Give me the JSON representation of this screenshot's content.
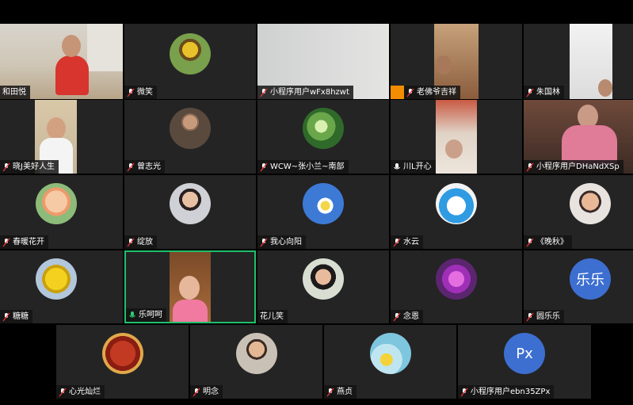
{
  "participants": [
    {
      "name": "和田悦"
    },
    {
      "name": "微笑"
    },
    {
      "name": "小程序用户wFx8hzwt"
    },
    {
      "name": "老佛爷吉祥"
    },
    {
      "name": "朱国林"
    },
    {
      "name": "晓J美好人生"
    },
    {
      "name": "曾志光"
    },
    {
      "name": "WCW~张小兰~南部"
    },
    {
      "name": "川L开心"
    },
    {
      "name": "小程序用户DHaNdXSp"
    },
    {
      "name": "春暖花开"
    },
    {
      "name": "绽放"
    },
    {
      "name": "我心向阳"
    },
    {
      "name": "水云"
    },
    {
      "name": "《晚秋》"
    },
    {
      "name": "糖糖"
    },
    {
      "name": "乐呵呵"
    },
    {
      "name": "花儿笑"
    },
    {
      "name": "念恩"
    },
    {
      "name": "圆乐乐",
      "avatar_text": "乐乐"
    },
    {
      "name": "心光灿烂"
    },
    {
      "name": "明念"
    },
    {
      "name": "燕贞"
    },
    {
      "name": "小程序用户ebn35ZPx",
      "avatar_text": "Px"
    }
  ],
  "colors": {
    "active_border": "#1fbf6b",
    "tile_bg": "#242424",
    "avatar_blue": "#3d6fd1"
  }
}
